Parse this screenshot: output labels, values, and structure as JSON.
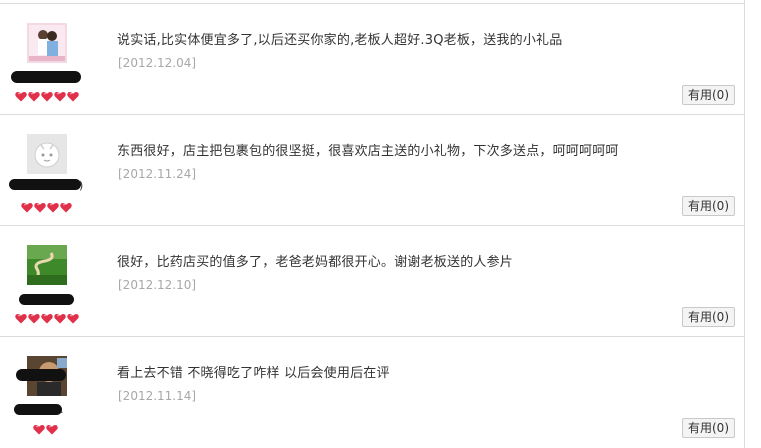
{
  "reviews": [
    {
      "comment": "说实话,比实体便宜多了,以后还买你家的,老板人超好.3Q老板，送我的小礼品",
      "date": "[2012.12.04]",
      "rating": 5,
      "useful_label": "有用(0)"
    },
    {
      "comment": "东西很好，店主把包裹包的很坚挺，很喜欢店主送的小礼物，下次多送点，呵呵呵呵呵",
      "date": "[2012.11.24]",
      "rating": 4,
      "useful_label": "有用(0)"
    },
    {
      "comment": "很好，比药店买的值多了，老爸老妈都很开心。谢谢老板送的人参片",
      "date": "[2012.12.10]",
      "rating": 5,
      "useful_label": "有用(0)"
    },
    {
      "comment": "看上去不错 不晓得吃了咋样 以后会使用后在评",
      "date": "[2012.11.14]",
      "rating": 2,
      "useful_label": "有用(0)"
    }
  ],
  "colors": {
    "heart": "#e0304a",
    "date": "#a8a8a8",
    "divider": "#dcdcdc"
  }
}
